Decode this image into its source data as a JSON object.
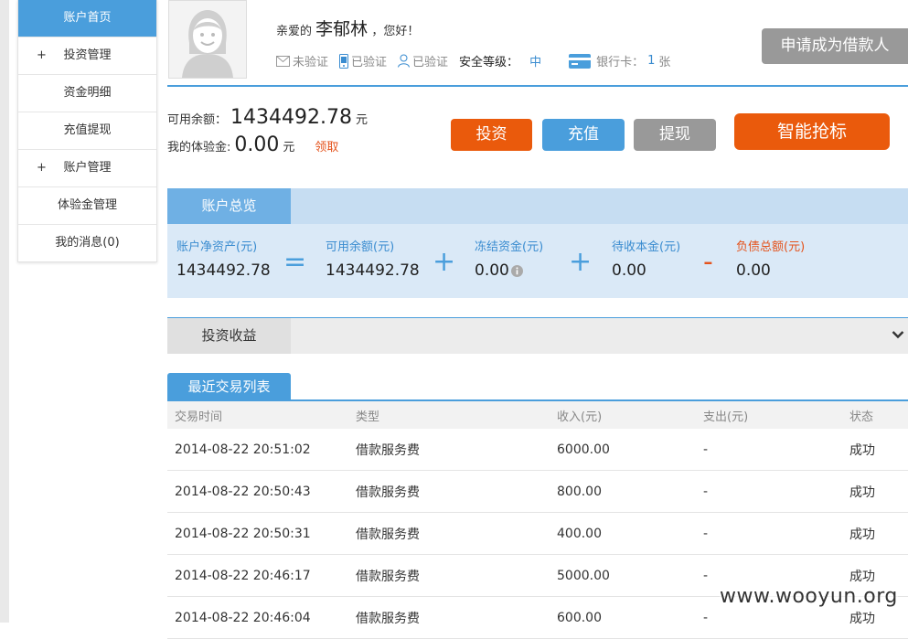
{
  "sidebar": {
    "items": [
      {
        "label": "账户首页",
        "active": true,
        "plus": ""
      },
      {
        "label": "投资管理",
        "active": false,
        "plus": "+"
      },
      {
        "label": "资金明细",
        "active": false,
        "plus": ""
      },
      {
        "label": "充值提现",
        "active": false,
        "plus": ""
      },
      {
        "label": "账户管理",
        "active": false,
        "plus": "+"
      },
      {
        "label": "体验金管理",
        "active": false,
        "plus": ""
      },
      {
        "label": "我的消息(0)",
        "active": false,
        "plus": ""
      }
    ]
  },
  "user": {
    "greeting_prefix": "亲爱的",
    "name": "李郁林",
    "greeting_suffix": "，您好！",
    "email_status": "未验证",
    "phone_status": "已验证",
    "identity_status": "已验证",
    "security_label": "安全等级：",
    "security_level": "中",
    "bank_label": "银行卡：",
    "bank_count": "1",
    "bank_unit": "张"
  },
  "apply_button": "申请成为借款人",
  "balance": {
    "available_label": "可用余额：",
    "available_value": "1434492.78",
    "available_unit": "元",
    "experience_label": "我的体验金:",
    "experience_value": "0.00",
    "experience_unit": "元",
    "claim_label": "领取"
  },
  "actions": {
    "invest": "投资",
    "recharge": "充值",
    "withdraw": "提现",
    "smart_bid": "智能抢标"
  },
  "overview": {
    "tab": "账户总览",
    "net_assets_label": "账户净资产(元)",
    "net_assets_value": "1434492.78",
    "op_equals": "=",
    "available_label": "可用余额(元)",
    "available_value": "1434492.78",
    "op_plus1": "+",
    "frozen_label": "冻结资金(元)",
    "frozen_value": "0.00",
    "op_plus2": "+",
    "pending_label": "待收本金(元)",
    "pending_value": "0.00",
    "op_minus": "-",
    "debt_label": "负债总额(元)",
    "debt_value": "0.00"
  },
  "income": {
    "tab": "投资收益"
  },
  "transactions": {
    "tab": "最近交易列表",
    "headers": [
      "交易时间",
      "类型",
      "收入(元)",
      "支出(元)",
      "状态"
    ],
    "rows": [
      [
        "2014-08-22 20:51:02",
        "借款服务费",
        "6000.00",
        "-",
        "成功"
      ],
      [
        "2014-08-22 20:50:43",
        "借款服务费",
        "800.00",
        "-",
        "成功"
      ],
      [
        "2014-08-22 20:50:31",
        "借款服务费",
        "400.00",
        "-",
        "成功"
      ],
      [
        "2014-08-22 20:46:17",
        "借款服务费",
        "5000.00",
        "-",
        "成功"
      ],
      [
        "2014-08-22 20:46:04",
        "借款服务费",
        "600.00",
        "-",
        "成功"
      ]
    ]
  },
  "watermark": "www.wooyun.org",
  "colors": {
    "primary_blue": "#4a9edc",
    "orange": "#ea5a0c",
    "gray_button": "#999999",
    "overview_bg": "#dae9f7"
  }
}
